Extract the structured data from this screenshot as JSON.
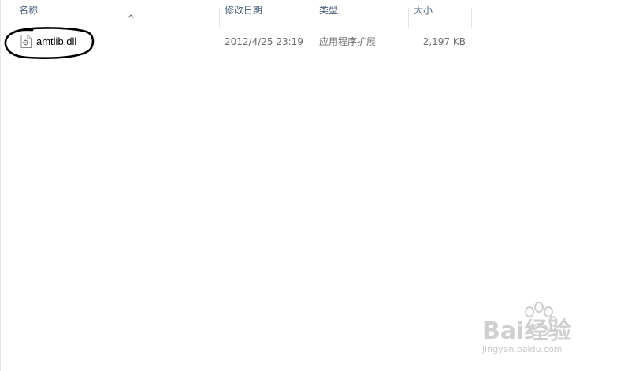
{
  "columns": {
    "name": "名称",
    "date": "修改日期",
    "type": "类型",
    "size": "大小"
  },
  "files": [
    {
      "name": "amtlib.dll",
      "modified": "2012/4/25 23:19",
      "type": "应用程序扩展",
      "size": "2,197 KB",
      "icon": "dll-file-icon"
    }
  ],
  "sort": {
    "column": "name",
    "direction": "ascending",
    "icon": "sort-ascending-icon"
  },
  "annotation": {
    "shape": "hand-drawn-ellipse",
    "color": "#000000"
  },
  "watermark": {
    "brand": "Bai经验",
    "url": "jingyan.baidu.com",
    "color": "#c8c8c8"
  }
}
